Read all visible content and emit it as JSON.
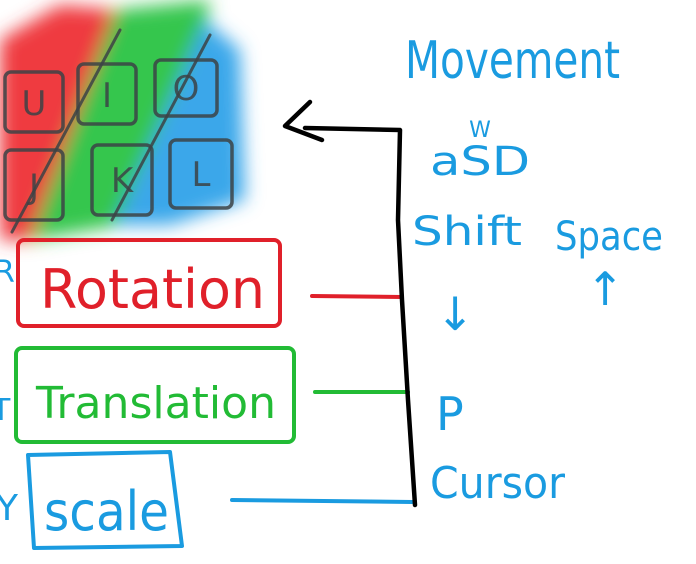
{
  "colors": {
    "red": "#e0202a",
    "green": "#22bb35",
    "blue": "#1a9be0",
    "black": "#000000",
    "red_blob": "#ef3a3f",
    "green_blob": "#36c64d",
    "blue_blob": "#3aa7ea",
    "key_outline": "#3c4346"
  },
  "keys": {
    "top": [
      "U",
      "I",
      "O"
    ],
    "bottom": [
      "J",
      "K",
      "L"
    ]
  },
  "labels": {
    "rotation": "Rotation",
    "translation": "Translation",
    "scale": "scale",
    "rotation_prefix": "R",
    "translation_prefix": "T",
    "scale_prefix": "Y"
  },
  "right_notes": {
    "heading": "Movement",
    "w": "W",
    "asd": "aSD",
    "shift": "Shift",
    "space": "Space",
    "down_arrow": "↓",
    "up_arrow": "↑",
    "p": "P",
    "cursor": "Cursor"
  }
}
